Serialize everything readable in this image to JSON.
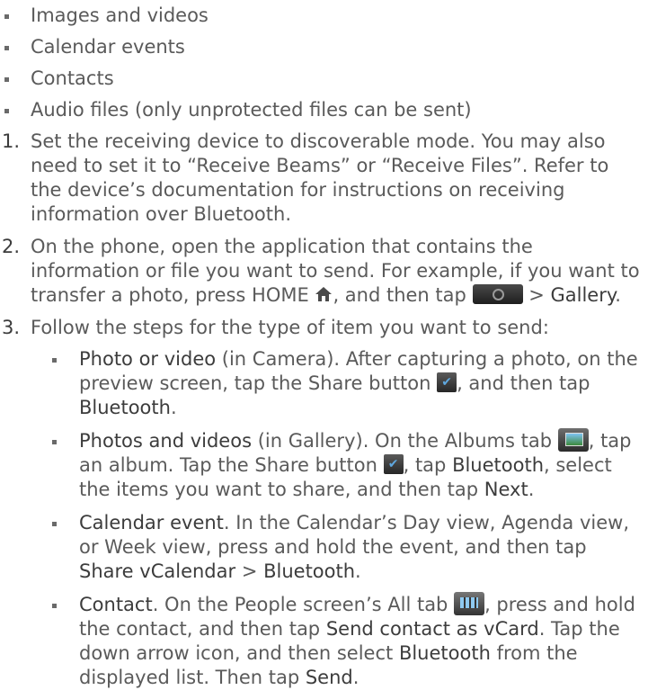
{
  "top_list": [
    "Images and videos",
    "Calendar events",
    "Contacts",
    "Audio files (only unprotected files can be sent)"
  ],
  "steps": {
    "s1": {
      "num": "1.",
      "text": "Set the receiving device to discoverable mode. You may also need to set it to “Receive Beams” or “Receive Files”. Refer to the device’s documentation for instructions on receiving information over Bluetooth."
    },
    "s2": {
      "num": "2.",
      "text_a": "On the phone, open the application that contains the information or file you want to send. For example, if you want to transfer a photo, press HOME ",
      "text_b": ", and then tap ",
      "text_c": " > ",
      "gallery": "Gallery",
      "text_d": "."
    },
    "s3": {
      "num": "3.",
      "text": "Follow the steps for the type of item you want to send:",
      "items": {
        "photo": {
          "title": "Photo or video",
          "t1": " (in Camera). After capturing a photo, on the preview screen, tap the Share button ",
          "t2": ", and then tap ",
          "bluetooth": "Bluetooth",
          "t3": "."
        },
        "gallery": {
          "title": "Photos and videos",
          "t1": " (in Gallery). On the Albums tab ",
          "t2": ", tap an album. Tap the Share button ",
          "t3": ", tap ",
          "bluetooth": "Bluetooth",
          "t4": ", select the items you want to share, and then tap ",
          "next": "Next",
          "t5": "."
        },
        "calendar": {
          "title": "Calendar event",
          "t1": ". In the Calendar’s Day view, Agenda view, or Week view, press and hold the event, and then tap ",
          "share": "Share vCalendar",
          "t2": " > ",
          "bluetooth": "Bluetooth",
          "t3": "."
        },
        "contact": {
          "title": "Contact",
          "t1": ". On the People screen’s All tab ",
          "t2": ", press and hold the contact, and then tap ",
          "send_vcard": "Send contact as vCard",
          "t3": ". Tap the down arrow icon, and then select ",
          "bluetooth": "Bluetooth",
          "t4": " from the displayed list. Then tap ",
          "send": "Send",
          "t5": "."
        }
      }
    }
  },
  "icons": {
    "home": "home-icon",
    "camera": "camera-app-icon",
    "share": "share-icon",
    "albums": "albums-tab-icon",
    "people_all": "people-all-tab-icon"
  },
  "colors": {
    "text": "#5a5a5a",
    "emphasis": "#3c3c3c"
  }
}
